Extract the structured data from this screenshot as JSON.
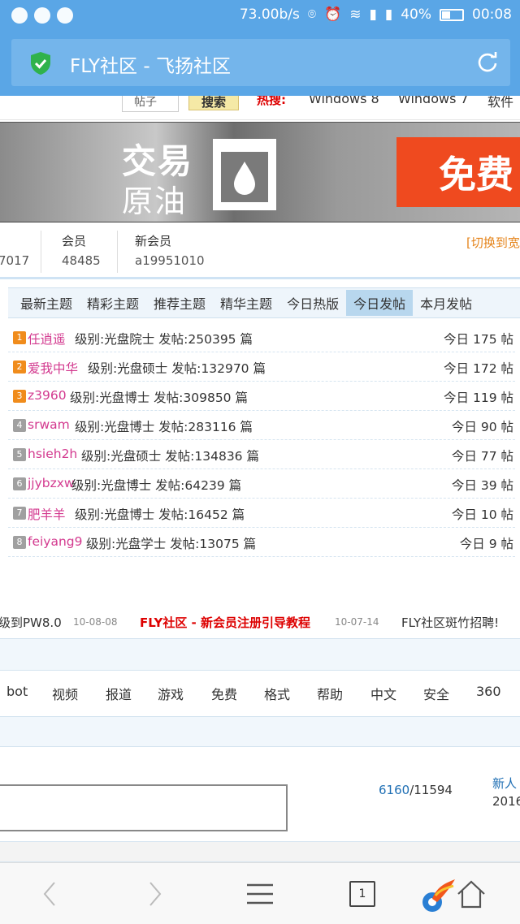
{
  "status_bar": {
    "network_speed": "73.00b/s",
    "battery": "40%",
    "battery_level": 0.4,
    "time": "00:08"
  },
  "browser": {
    "page_title": "FLY社区 - 飞扬社区"
  },
  "search_row": {
    "select_value": "帖子",
    "search_button": "搜索",
    "hot_label": "热搜:",
    "hot_tags": [
      "Windows 8",
      "Windows 7",
      "软件"
    ]
  },
  "banner": {
    "line1": "交易",
    "line2": "原油",
    "cta": "免费"
  },
  "stats": {
    "first_value_partial": "7017",
    "members_label": "会员",
    "members_value": "48485",
    "new_member_label": "新会员",
    "new_member_value": "a19951010",
    "switch_label": "[切换到宽"
  },
  "tabs": [
    {
      "label": "最新主题",
      "active": false
    },
    {
      "label": "精彩主题",
      "active": false
    },
    {
      "label": "推荐主题",
      "active": false
    },
    {
      "label": "精华主题",
      "active": false
    },
    {
      "label": "今日热版",
      "active": false
    },
    {
      "label": "今日发帖",
      "active": true
    },
    {
      "label": "本月发帖",
      "active": false
    }
  ],
  "ranking": [
    {
      "rank": "1",
      "name": "任逍遥",
      "info": "级别:光盘院士 发帖:250395 篇",
      "today": "今日 175 帖",
      "color": "#f08c1c"
    },
    {
      "rank": "2",
      "name": "爱我中华",
      "info": "级别:光盘硕士 发帖:132970 篇",
      "today": "今日 172 帖",
      "color": "#f08c1c"
    },
    {
      "rank": "3",
      "name": "z3960",
      "info": "级别:光盘博士 发帖:309850 篇",
      "today": "今日 119 帖",
      "color": "#f08c1c"
    },
    {
      "rank": "4",
      "name": "srwam",
      "info": "级别:光盘博士 发帖:283116 篇",
      "today": "今日 90 帖",
      "color": "#a0a0a0"
    },
    {
      "rank": "5",
      "name": "hsieh2h",
      "info": "级别:光盘硕士 发帖:134836 篇",
      "today": "今日 77 帖",
      "color": "#a0a0a0"
    },
    {
      "rank": "6",
      "name": "jjybzxw",
      "info": "级别:光盘博士 发帖:64239 篇",
      "today": "今日 39 帖",
      "color": "#a0a0a0"
    },
    {
      "rank": "7",
      "name": "肥羊羊",
      "info": "级别:光盘博士 发帖:16452 篇",
      "today": "今日 10 帖",
      "color": "#a0a0a0"
    },
    {
      "rank": "8",
      "name": "feiyang9",
      "info": "级别:光盘学士 发帖:13075 篇",
      "today": "今日 9 帖",
      "color": "#a0a0a0"
    }
  ],
  "news": {
    "item1": "级到PW8.0",
    "date1": "10-08-08",
    "item2": "FLY社区 - 新会员注册引导教程",
    "date2": "10-07-14",
    "item3": "FLY社区斑竹招聘!"
  },
  "keywords": [
    "bot",
    "视频",
    "报道",
    "游戏",
    "免费",
    "格式",
    "帮助",
    "中文",
    "安全",
    "360"
  ],
  "lower": {
    "ratio_a": "6160",
    "ratio_b": "/11594",
    "new_label": "新人",
    "year": "2016"
  },
  "bottom_nav": {
    "tab_count": "1"
  }
}
